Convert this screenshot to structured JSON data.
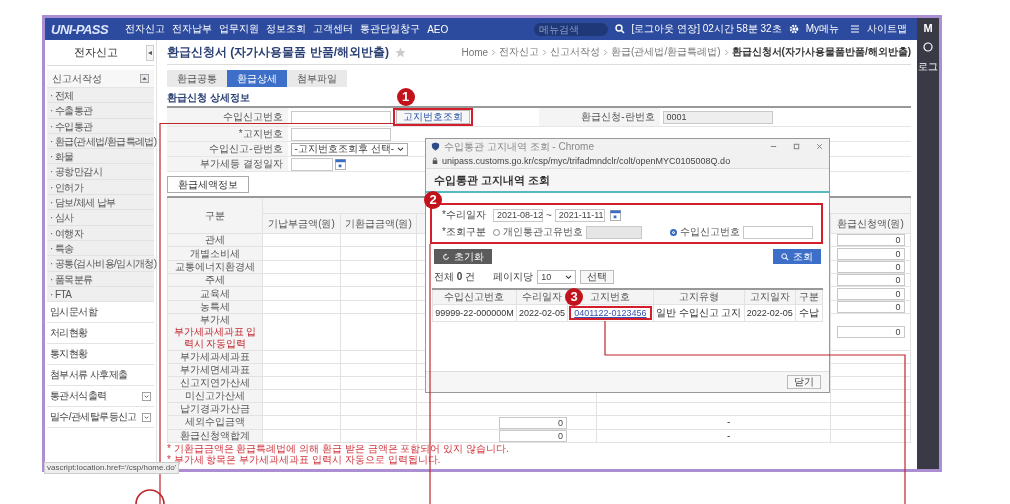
{
  "header": {
    "logo": "UNI-PASS",
    "menu": [
      "전자신고",
      "전자납부",
      "업무지원",
      "정보조회",
      "고객센터",
      "통관단일창구",
      "AEO"
    ],
    "search": {
      "placeholder": "메뉴검색"
    },
    "session": "[로그아웃 연장] 02시간 58분 32초",
    "my_menu": "My메뉴",
    "sitemap": "사이트맵"
  },
  "edge": {
    "letter": "M",
    "label": "로그"
  },
  "sidebar": {
    "title": "전자신고",
    "collapse": "◂",
    "section": {
      "label": "신고서작성",
      "expanded": true,
      "items": [
        "· 전체",
        "· 수출통관",
        "· 수입통관",
        "· 환급(관세법/환급특례법)",
        "· 화물",
        "· 공항만감시",
        "· 인허가",
        "· 담보/체세 납부",
        "· 심사",
        "· 여행자",
        "· 특송",
        "· 공통(검사비용/임시개청)",
        "· 품목분류",
        "· FTA"
      ]
    },
    "menus": [
      {
        "label": "임시문서함",
        "kind": "link"
      },
      {
        "label": "처리현황",
        "kind": "link"
      },
      {
        "label": "통지현황",
        "kind": "link"
      },
      {
        "label": "첨부서류 사후제출",
        "kind": "link"
      },
      {
        "label": "통관서식출력",
        "kind": "dropdown"
      },
      {
        "label": "밀수/관세탈루등신고",
        "kind": "dropdown"
      }
    ]
  },
  "page": {
    "title": "환급신청서 (자가사용물품 반품/해외반출)",
    "favorite": false,
    "breadcrumb": [
      "Home",
      "전자신고",
      "신고서작성",
      "환급(관세법/환급특례법)",
      "환급신청서(자가사용물품반품/해외반출)"
    ]
  },
  "tabs": [
    {
      "label": "환급공통",
      "selected": false
    },
    {
      "label": "환급상세",
      "selected": true
    },
    {
      "label": "첨부파일",
      "selected": false
    }
  ],
  "detail": {
    "title": "환급신청 상세정보",
    "fields": [
      {
        "label": "수입신고번호",
        "kind": "lookup",
        "button": "고지번호조회"
      },
      {
        "label": "*고지번호",
        "kind": "text"
      },
      {
        "label": "수입신고-란번호",
        "kind": "select",
        "value": "-고지번호조회후 선택-"
      },
      {
        "label": "부가세등 결정일자",
        "kind": "date"
      }
    ],
    "side_field": {
      "label": "환급신청-란번호",
      "value": "0001"
    }
  },
  "tax_button": "환급세액정보",
  "tax_table": {
    "columns": [
      "구분",
      "기납부금액(원)",
      "기환급금액(원)",
      "환급신청액(원)"
    ],
    "rows": [
      {
        "label": "관세",
        "refund": "0"
      },
      {
        "label": "개별소비세",
        "refund": "0"
      },
      {
        "label": "교통에너지환경세",
        "refund": "0"
      },
      {
        "label": "주세",
        "refund": "0"
      },
      {
        "label": "교육세",
        "refund": "0"
      },
      {
        "label": "농특세",
        "refund": "0"
      },
      {
        "label": "부가세",
        "note": "부가세과세과표 입력시 자동입력",
        "refund": "0"
      },
      {
        "label": "부가세과세과표"
      },
      {
        "label": "부가세면세과표"
      },
      {
        "label": "신고지연가산세"
      },
      {
        "label": "미신고가산세"
      },
      {
        "label": "납기경과가산금"
      },
      {
        "label": "세외수입금액",
        "column_4": "0",
        "column_5": "-"
      },
      {
        "label": "환급신청액합계",
        "column_4": "0",
        "column_5": "-"
      }
    ]
  },
  "notes": [
    "* 기환급금액은 환급특례법에 의해 환급 받은 금액은 포함되어 있지 않습니다.",
    "* 부가세 항목은 부가세과세과표 입력시 자동으로 입력됩니다."
  ],
  "status_text": "vascript:location.href='/csp/home.do'",
  "popup": {
    "title": "수입통관 고지내역 조회 - Chrome",
    "url": "unipass.customs.go.kr/csp/myc/trifadmndclr/colt/openMYC0105008Q.do",
    "heading": "수입통관 고지내역 조회",
    "date_label": "*수리일자",
    "date_from": "2021-08-12",
    "date_sep": "~",
    "date_to": "2021-11-11",
    "type_label": "*조회구분",
    "options": [
      {
        "label": "개인통관고유번호",
        "selected": false
      },
      {
        "label": "수입신고번호",
        "selected": true
      }
    ],
    "reset": "초기화",
    "search": "조회",
    "total": "전체 **0** 건",
    "per_page_label": "페이지당",
    "per_page": "10",
    "apply": "선택",
    "columns": [
      "수입신고번호",
      "수리일자",
      "고지번호",
      "고지유형",
      "고지일자",
      "구분"
    ],
    "rows": [
      {
        "declaration": "99999-22-000000M",
        "accepted": "2022-02-05",
        "notice_no": "0401122-0123456",
        "notice_type": "일반 수입신고 고지",
        "notice_date": "2022-02-05",
        "category": "수납"
      }
    ],
    "close": "닫기"
  },
  "markers": [
    "1",
    "2",
    "3"
  ]
}
